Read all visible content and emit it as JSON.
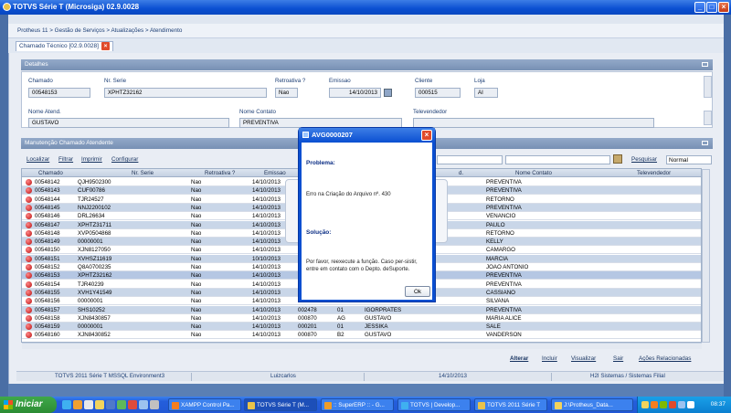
{
  "window": {
    "title": "TOTVS Série T  (Microsiga) 02.9.0028"
  },
  "breadcrumb": "Protheus 11 > Gestão de Serviços > Atualizações > Atendimento",
  "tab": {
    "label": "Chamado Técnico [02.9.0028]"
  },
  "details": {
    "header": "Detalhes",
    "fields": {
      "chamado": {
        "label": "Chamado",
        "value": "00548153"
      },
      "nrserie": {
        "label": "Nr. Serie",
        "value": "XPHTZ32162"
      },
      "retroativa": {
        "label": "Retroativa ?",
        "value": "Nao"
      },
      "emissao": {
        "label": "Emissao",
        "value": "14/10/2013"
      },
      "cliente": {
        "label": "Cliente",
        "value": "000515"
      },
      "loja": {
        "label": "Loja",
        "value": "AI"
      },
      "nomeatend": {
        "label": "Nome Atend.",
        "value": "GUSTAVO"
      },
      "nomecontato": {
        "label": "Nome Contato",
        "value": "PREVENTIVA"
      },
      "televendedor": {
        "label": "Televendedor",
        "value": ""
      }
    }
  },
  "manutencao": {
    "header": "Manutenção Chamado Atendente",
    "links": {
      "localizar": "Localizar",
      "filtrar": "Filtrar",
      "imprimir": "Imprimir",
      "configurar": "Configurar"
    },
    "search_button": "Pesquisar",
    "view_select": "Normal",
    "columns": {
      "chamado": "Chamado",
      "nrserie": "Nr. Serie",
      "retroativa": "Retroativa ?",
      "emissao": "Emissao",
      "d": "d.",
      "nomecontato": "Nome Contato",
      "televendedor": "Televendedor"
    },
    "rows": [
      {
        "chamado": "00548142",
        "serie": "QJH9502300",
        "retro": "Nao",
        "emissao": "14/10/2013",
        "c5": "",
        "c6": "",
        "nome": "",
        "contato": "PREVENTIVA"
      },
      {
        "chamado": "00548143",
        "serie": "CUF00786",
        "retro": "Nao",
        "emissao": "14/10/2013",
        "c5": "",
        "c6": "",
        "nome": "",
        "contato": "PREVENTIVA"
      },
      {
        "chamado": "00548144",
        "serie": "TJR24527",
        "retro": "Nao",
        "emissao": "14/10/2013",
        "c5": "",
        "c6": "",
        "nome": "",
        "contato": "RETORNO"
      },
      {
        "chamado": "00548145",
        "serie": "NNJ2200102",
        "retro": "Nao",
        "emissao": "14/10/2013",
        "c5": "",
        "c6": "",
        "nome": "",
        "contato": "PREVENTIVA"
      },
      {
        "chamado": "00548146",
        "serie": "DRL26634",
        "retro": "Nao",
        "emissao": "14/10/2013",
        "c5": "",
        "c6": "",
        "nome": "",
        "contato": "VENANCIO"
      },
      {
        "chamado": "00548147",
        "serie": "XPHTZ31711",
        "retro": "Nao",
        "emissao": "14/10/2013",
        "c5": "",
        "c6": "",
        "nome": "",
        "contato": "PAULO"
      },
      {
        "chamado": "00548148",
        "serie": "XVP0504868",
        "retro": "Nao",
        "emissao": "14/10/2013",
        "c5": "",
        "c6": "",
        "nome": "",
        "contato": "RETORNO"
      },
      {
        "chamado": "00548149",
        "serie": "00000001",
        "retro": "Nao",
        "emissao": "14/10/2013",
        "c5": "",
        "c6": "",
        "nome": "",
        "contato": "KELLY"
      },
      {
        "chamado": "00548150",
        "serie": "XJN8127050",
        "retro": "Nao",
        "emissao": "14/10/2013",
        "c5": "",
        "c6": "",
        "nome": "",
        "contato": "CAMARGO"
      },
      {
        "chamado": "00548151",
        "serie": "XVHSZ11619",
        "retro": "Nao",
        "emissao": "10/10/2013",
        "c5": "",
        "c6": "",
        "nome": "",
        "contato": "MARCIA"
      },
      {
        "chamado": "00548152",
        "serie": "Q8A0700235",
        "retro": "Nao",
        "emissao": "14/10/2013",
        "c5": "",
        "c6": "",
        "nome": "",
        "contato": "JOAO ANTONIO"
      },
      {
        "chamado": "00548153",
        "serie": "XPHTZ32162",
        "retro": "Nao",
        "emissao": "14/10/2013",
        "c5": "",
        "c6": "",
        "nome": "",
        "contato": "PREVENTIVA"
      },
      {
        "chamado": "00548154",
        "serie": "TJR40239",
        "retro": "Nao",
        "emissao": "14/10/2013",
        "c5": "",
        "c6": "",
        "nome": "",
        "contato": "PREVENTIVA"
      },
      {
        "chamado": "00548155",
        "serie": "XVH1Y41549",
        "retro": "Nao",
        "emissao": "14/10/2013",
        "c5": "",
        "c6": "",
        "nome": "",
        "contato": "CASSIANO"
      },
      {
        "chamado": "00548156",
        "serie": "00000001",
        "retro": "Nao",
        "emissao": "14/10/2013",
        "c5": "",
        "c6": "",
        "nome": "",
        "contato": "SILVANA"
      },
      {
        "chamado": "00548157",
        "serie": "SHS10252",
        "retro": "Nao",
        "emissao": "14/10/2013",
        "c5": "002478",
        "c6": "01",
        "nome": "IGORPRATES",
        "contato": "PREVENTIVA"
      },
      {
        "chamado": "00548158",
        "serie": "XJN8430857",
        "retro": "Nao",
        "emissao": "14/10/2013",
        "c5": "000870",
        "c6": "AG",
        "nome": "GUSTAVO",
        "contato": "MARIA ALICE"
      },
      {
        "chamado": "00548159",
        "serie": "00000001",
        "retro": "Nao",
        "emissao": "14/10/2013",
        "c5": "000201",
        "c6": "01",
        "nome": "JESSIKA",
        "contato": "SALE"
      },
      {
        "chamado": "00548160",
        "serie": "XJN8430852",
        "retro": "Nao",
        "emissao": "14/10/2013",
        "c5": "000870",
        "c6": "B2",
        "nome": "GUSTAVO",
        "contato": "VANDERSON"
      }
    ]
  },
  "actions": {
    "alterar": "Alterar",
    "incluir": "Incluir",
    "visualizar": "Visualizar",
    "sair": "Sair",
    "acoes": "Ações Relacionadas"
  },
  "status": {
    "env": "TOTVS 2011 Série T  MSSQL Environment3",
    "user": "Luizcarlos",
    "date": "14/10/2013",
    "company": "H2I Sistemas / Sistemas Filial"
  },
  "dialog": {
    "title": "AVG0000207",
    "problem_label": "Problema:",
    "problem_text": "Erro na Criação do Arquivo nº. 430",
    "solution_label": "Solução:",
    "solution_text": "Por favor, reexecute a função. Caso per-sistir, entre em contato com o Depto. deSuporte.",
    "ok": "Ok"
  },
  "taskbar": {
    "start": "Iniciar",
    "tasks": [
      "XAMPP Control Pa...",
      "TOTVS Série T  (M...",
      ":: SuperERP :: - G...",
      "TOTVS | Develop...",
      "TOTVS 2011 Série T",
      "J:\\Protheus_Data..."
    ],
    "clock": "08:37"
  }
}
